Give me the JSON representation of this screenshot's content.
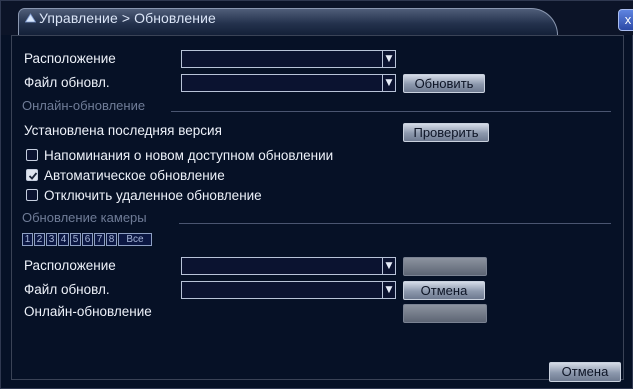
{
  "window": {
    "title": "Управление > Обновление",
    "close_label": "x"
  },
  "local_update": {
    "location_label": "Расположение",
    "location_value": "",
    "file_label": "Файл обновл.",
    "file_value": "",
    "update_button": "Обновить"
  },
  "online_update": {
    "section_title": "Онлайн-обновление",
    "status_text": "Установлена последняя версия",
    "check_button": "Проверить",
    "options": [
      {
        "label": "Напоминания о новом доступном обновлении",
        "checked": false
      },
      {
        "label": "Автоматическое обновление",
        "checked": true
      },
      {
        "label": "Отключить удаленное обновление",
        "checked": false
      }
    ]
  },
  "camera_update": {
    "section_title": "Обновление камеры",
    "channels": [
      "1",
      "2",
      "3",
      "4",
      "5",
      "6",
      "7",
      "8",
      "Все"
    ],
    "location_label": "Расположение",
    "location_value": "",
    "file_label": "Файл обновл.",
    "file_value": "",
    "cancel_button": "Отмена",
    "online_label": "Онлайн-обновление"
  },
  "footer": {
    "cancel_button": "Отмена"
  }
}
